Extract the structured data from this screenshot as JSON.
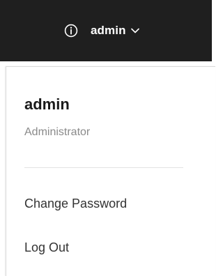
{
  "header": {
    "info_icon": "info-icon",
    "user_label": "admin",
    "chevron_icon": "chevron-down-icon"
  },
  "user_menu": {
    "username": "admin",
    "role": "Administrator",
    "items": [
      {
        "label": "Change Password"
      },
      {
        "label": "Log Out"
      }
    ]
  },
  "colors": {
    "topbar_bg": "#1f1f1f",
    "topbar_text": "#ffffff",
    "menu_bg": "#ffffff",
    "role_text": "#8a8a8a",
    "item_text": "#333333"
  }
}
